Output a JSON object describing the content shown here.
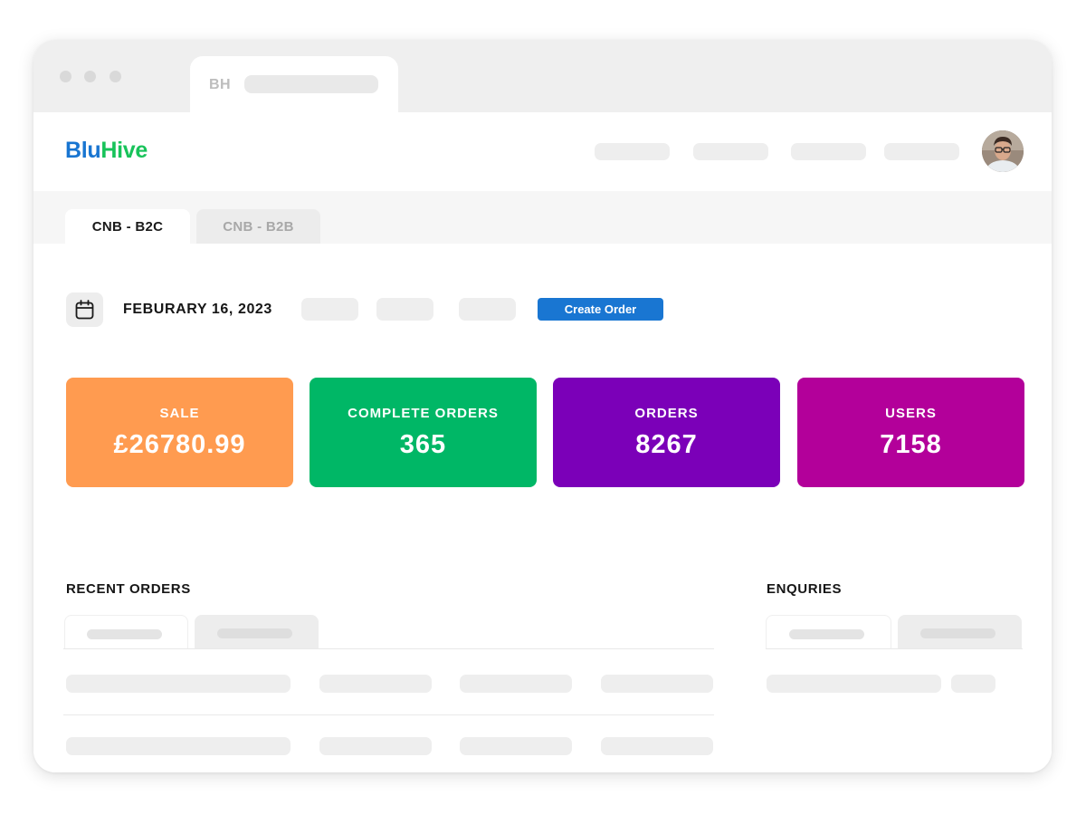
{
  "browser": {
    "tab_label": "BH"
  },
  "app": {
    "logo_part1": "Blu",
    "logo_part2": "Hive",
    "brand_blue": "#1875d1",
    "brand_green": "#18c35a"
  },
  "tabs": [
    {
      "label": "CNB - B2C",
      "active": true
    },
    {
      "label": "CNB - B2B",
      "active": false
    }
  ],
  "toolbar": {
    "calendar_icon": "calendar-icon",
    "date": "FEBURARY 16, 2023",
    "create_order_label": "Create Order",
    "accent": "#1976d2"
  },
  "stats": [
    {
      "label": "SALE",
      "value": "£26780.99",
      "color": "#ff9b50"
    },
    {
      "label": "COMPLETE ORDERS",
      "value": "365",
      "color": "#00b766"
    },
    {
      "label": "ORDERS",
      "value": "8267",
      "color": "#7b00b8"
    },
    {
      "label": "USERS",
      "value": "7158",
      "color": "#b3009a"
    }
  ],
  "sections": {
    "recent_orders_title": "RECENT ORDERS",
    "enquiries_title": "ENQURIES"
  }
}
